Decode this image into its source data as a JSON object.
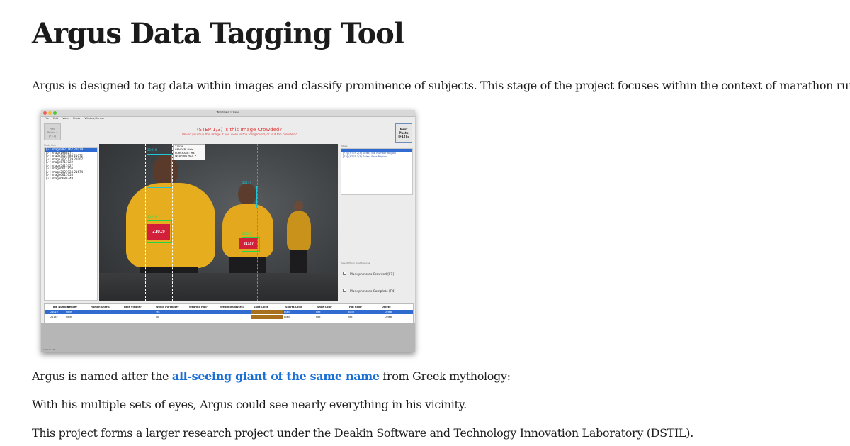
{
  "page": {
    "title": "Argus Data Tagging Tool",
    "intro": "Argus is designed to tag data within images and classify prominence of subjects. This stage of the project focuses within the context of marathon runners.",
    "named_before": "Argus is named after the ",
    "named_link": "all-seeing giant of the same name",
    "named_after": " from Greek mythology:",
    "eyes": "With his multiple sets of eyes, Argus could see nearly everything in his vicinity.",
    "project": "This project forms a larger research project under the Deakin Software and Technology Innovation Laboratory (DSTIL)."
  },
  "screenshot": {
    "window_title": "Windows 10 x64",
    "menu": [
      "File",
      "Edit",
      "View",
      "Photo",
      "Window/Runner"
    ],
    "prev_button": [
      "Prev",
      "Photo ◂",
      "[F11]"
    ],
    "next_button": [
      "Next",
      "Photo",
      "[F12] ▸"
    ],
    "step_title": "(STEP 1/3) Is this Image Crowded?",
    "step_subtitle": "Would you buy this image if you were in the foreground, or is it too crowded?",
    "files_label": "Photo files",
    "files": [
      "[✓] Image9821167 21019",
      "[✓] Image1986271",
      "[✓] Image3021984 21072",
      "[✓] Image3021129 21007",
      "[✓] Image6711022",
      "[✓] Image5411027",
      "[✓] Image6611850",
      "[✓] Image2021924 21674",
      "[✓] Image6611058",
      "[✓] Image6689349"
    ],
    "tooltip": [
      "21019",
      "GENDER: Male",
      "PURCHASE: Yes",
      "WEARING HAT: ✔"
    ],
    "bib_left": "21019",
    "bib_right": "21147",
    "box_labels": [
      "21019",
      "21147",
      "21019",
      "21147"
    ],
    "steps_label": "Steps",
    "steps": [
      "[F1] (STEP 1/3) Is this Image Crowded?",
      "[F2] (STEP 2/3) Select Bib Number Region",
      "[F3] (STEP 3/3) Select Face Region"
    ],
    "options_label": "Saved Photo Qualifications",
    "crowded_label": "Mark photo as Crowded [F1]",
    "complete_label": "Mark photo as Complete [F4]",
    "grid_headers": [
      "Bib Number",
      "Gender",
      "Human Sharp?",
      "Face Visible?",
      "Would Purchase?",
      "Wearing Hat?",
      "Wearing Glasses?",
      "Shirt Color",
      "Shorts Color",
      "Shoe Color",
      "Hat Color",
      "Delete"
    ],
    "grid_rows": [
      [
        "21019",
        "Male",
        "Yes",
        "Black",
        "Red",
        "Black",
        "Delete"
      ],
      [
        "21147",
        "Male",
        "No",
        "Black",
        "Red",
        "Red",
        "Delete"
      ]
    ],
    "status": "1/70 to 400"
  },
  "colors": {
    "link": "#1a6fd4",
    "step_text": "#e23c3c",
    "box_face": "#1ec6d8",
    "box_bib": "#27d44c",
    "selection": "#2f6bd1"
  }
}
